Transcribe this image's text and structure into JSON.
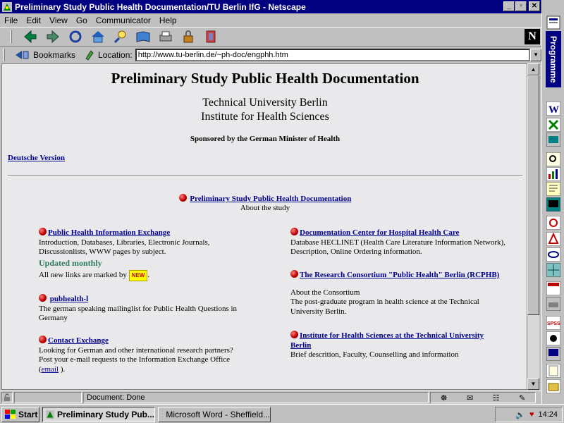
{
  "window": {
    "title": "Preliminary Study Public Health Documentation/TU Berlin IfG - Netscape",
    "buttons": [
      "_",
      "▫",
      "✕"
    ]
  },
  "menu": [
    "File",
    "Edit",
    "View",
    "Go",
    "Communicator",
    "Help"
  ],
  "toolbar_icons": [
    "back-icon",
    "forward-icon",
    "reload-icon",
    "home-icon",
    "search-icon",
    "guide-icon",
    "print-icon",
    "security-icon",
    "stop-icon"
  ],
  "location_bar": {
    "bookmarks_label": "Bookmarks",
    "location_label": "Location:",
    "url": "http://www.tu-berlin.de/~ph-doc/engphh.htm"
  },
  "page": {
    "title": "Preliminary Study Public Health Documentation",
    "university": "Technical University Berlin",
    "institute": "Institute for Health Sciences",
    "sponsor": "Sponsored by the German Minister of Health",
    "german_link": "Deutsche Version",
    "main_link": "Preliminary Study Public Health Documentation",
    "main_sub": "About the study",
    "left": {
      "phie_link": "Public Health Information Exchange",
      "phie_desc1": "Introduction, Databases, Libraries, Electronic Journals,",
      "phie_desc2": "Discussionlists, WWW pages by subject.",
      "updated": "Updated monthly",
      "new_note": "All new links are marked by",
      "new_badge": "NEW",
      "new_after": ".",
      "pubhealth_link": "pubhealth-l",
      "pubhealth_desc1": "The german speaking mailinglist for Public Health Questions in",
      "pubhealth_desc2": "Germany",
      "contact_link": "Contact Exchange",
      "contact_desc1": "Looking for German and other international research partners?",
      "contact_desc2": "Post your e-mail requests to the Information Exchange Office",
      "contact_open": "(",
      "email_link": "email",
      "contact_close": " )."
    },
    "right": {
      "doc_link": "Documentation Center for Hospital Health Care",
      "doc_desc1": "Database HECLINET (Health Care Literature Information Network),",
      "doc_desc2": "Description, Online Ordering information.",
      "rc_link": "The Research Consortium \"Public Health\" Berlin (RCPHB)",
      "rc_desc1": "About the Consortium",
      "rc_desc2": "The post-graduate program in health science at the Technical",
      "rc_desc3": "University Berlin.",
      "ihs_link1": "Institute for Health Sciences at the Technical University",
      "ihs_link2": "Berlin",
      "ihs_desc": "Brief descrition, Faculty, Counselling and information"
    }
  },
  "status": {
    "text": "Document: Done"
  },
  "sidebar": {
    "label": "Programme"
  },
  "taskbar": {
    "start": "Start",
    "task1": "Preliminary Study Pub...",
    "task2": "Microsoft Word - Sheffield...",
    "clock": "14:24"
  },
  "colors": {
    "titlebar": "#000080",
    "link": "#00008b",
    "page_bg": "#e9e9ec",
    "updated_green": "#2e7d5b",
    "bullet_red": "#c00000"
  }
}
